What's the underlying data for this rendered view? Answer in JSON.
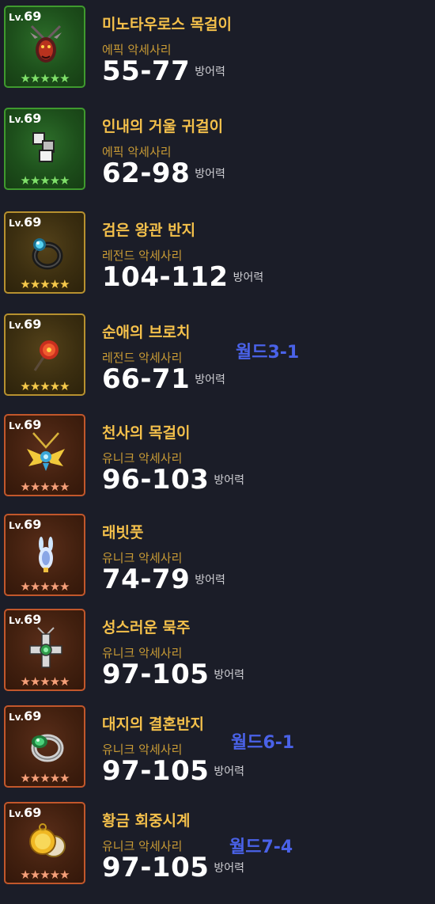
{
  "colors": {
    "epic": "#3f9a2e",
    "legend": "#b7912f",
    "unique": "#c2572b",
    "world": "#4a62e8"
  },
  "items": [
    {
      "lv_prefix": "Lv.",
      "lv": "69",
      "stars": "★★★★★",
      "name": "미노타우로스 목걸이",
      "type": "에픽 악세사리",
      "value": "55-77",
      "unit": "방어력",
      "icon": "minotaur-necklace-icon"
    },
    {
      "lv_prefix": "Lv.",
      "lv": "69",
      "stars": "★★★★★",
      "name": "인내의 거울 귀걸이",
      "type": "에픽 악세사리",
      "value": "62-98",
      "unit": "방어력",
      "icon": "mirror-earring-icon"
    },
    {
      "lv_prefix": "Lv.",
      "lv": "69",
      "stars": "★★★★★",
      "name": "검은 왕관 반지",
      "type": "레전드 악세사리",
      "value": "104-112",
      "unit": "방어력",
      "icon": "black-ring-icon"
    },
    {
      "lv_prefix": "Lv.",
      "lv": "69",
      "stars": "★★★★★",
      "name": "순애의 브로치",
      "type": "레전드 악세사리",
      "value": "66-71",
      "unit": "방어력",
      "icon": "rose-brooch-icon",
      "world": "월드3-1"
    },
    {
      "lv_prefix": "Lv.",
      "lv": "69",
      "stars": "★★★★★",
      "name": "천사의 목걸이",
      "type": "유니크 악세사리",
      "value": "96-103",
      "unit": "방어력",
      "icon": "angel-necklace-icon"
    },
    {
      "lv_prefix": "Lv.",
      "lv": "69",
      "stars": "★★★★★",
      "name": "래빗풋",
      "type": "유니크 악세사리",
      "value": "74-79",
      "unit": "방어력",
      "icon": "rabbit-foot-icon"
    },
    {
      "lv_prefix": "Lv.",
      "lv": "69",
      "stars": "★★★★★",
      "name": "성스러운 묵주",
      "type": "유니크 악세사리",
      "value": "97-105",
      "unit": "방어력",
      "icon": "rosary-icon"
    },
    {
      "lv_prefix": "Lv.",
      "lv": "69",
      "stars": "★★★★★",
      "name": "대지의 결혼반지",
      "type": "유니크 악세사리",
      "value": "97-105",
      "unit": "방어력",
      "icon": "earth-ring-icon",
      "world": "월드6-1"
    },
    {
      "lv_prefix": "Lv.",
      "lv": "69",
      "stars": "★★★★★",
      "name": "황금 회중시계",
      "type": "유니크 악세사리",
      "value": "97-105",
      "unit": "방어력",
      "icon": "pocket-watch-icon",
      "world": "월드7-4"
    }
  ]
}
